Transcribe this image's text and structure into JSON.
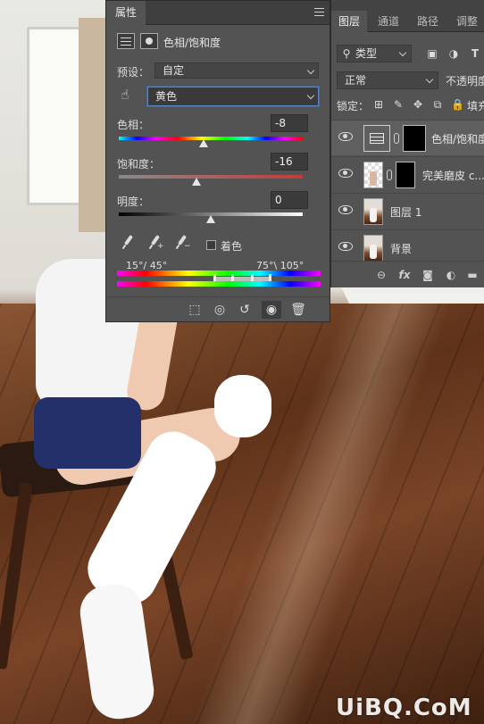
{
  "properties_panel": {
    "tab_label": "属性",
    "adjustment_title": "色相/饱和度",
    "preset_label": "预设：",
    "preset_value": "自定",
    "channel_value": "黄色",
    "hue": {
      "label": "色相：",
      "value": "-8",
      "level": 0.46
    },
    "saturation": {
      "label": "饱和度：",
      "value": "-16",
      "level": 0.42
    },
    "lightness": {
      "label": "明度：",
      "value": "0",
      "level": 0.5
    },
    "colorize_label": "着色",
    "range_left": "15°/ 45°",
    "range_right": "75°\\ 105°"
  },
  "layers_panel": {
    "tabs": [
      "图层",
      "通道",
      "路径",
      "调整"
    ],
    "kind_filter": "类型",
    "blend_mode": "正常",
    "opacity_label": "不透明度",
    "lock_label": "锁定：",
    "fill_label": "填充",
    "layers": [
      {
        "name": "色相/饱和度",
        "selected": true
      },
      {
        "name": "完美磨皮 c...",
        "selected": false
      },
      {
        "name": "图层 1",
        "selected": false
      },
      {
        "name": "背景",
        "selected": false
      }
    ]
  },
  "watermark": "UiBQ.CoM"
}
